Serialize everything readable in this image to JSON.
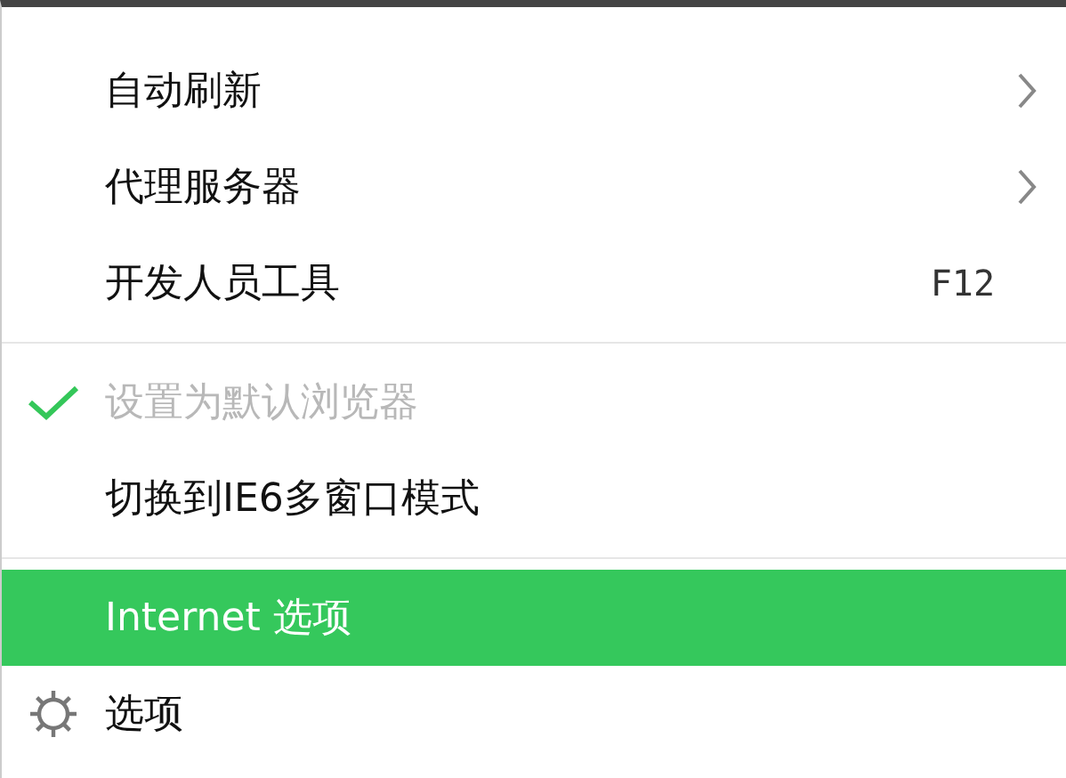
{
  "menu": {
    "items": [
      {
        "kind": "item",
        "label": "自动刷新",
        "submenu": true,
        "checked": false,
        "disabled": false,
        "selected": false
      },
      {
        "kind": "item",
        "label": "代理服务器",
        "submenu": true,
        "checked": false,
        "disabled": false,
        "selected": false
      },
      {
        "kind": "item",
        "label": "开发人员工具",
        "shortcut": "F12",
        "submenu": false,
        "checked": false,
        "disabled": false,
        "selected": false
      },
      {
        "kind": "separator"
      },
      {
        "kind": "item",
        "label": "设置为默认浏览器",
        "submenu": false,
        "checked": true,
        "disabled": true,
        "selected": false
      },
      {
        "kind": "item",
        "label": "切换到IE6多窗口模式",
        "submenu": false,
        "checked": false,
        "disabled": false,
        "selected": false
      },
      {
        "kind": "separator"
      },
      {
        "kind": "item",
        "label": "Internet 选项",
        "submenu": false,
        "checked": false,
        "disabled": false,
        "selected": true
      },
      {
        "kind": "settings-item",
        "label": "选项",
        "submenu": false,
        "checked": false,
        "disabled": false,
        "selected": false
      }
    ]
  }
}
